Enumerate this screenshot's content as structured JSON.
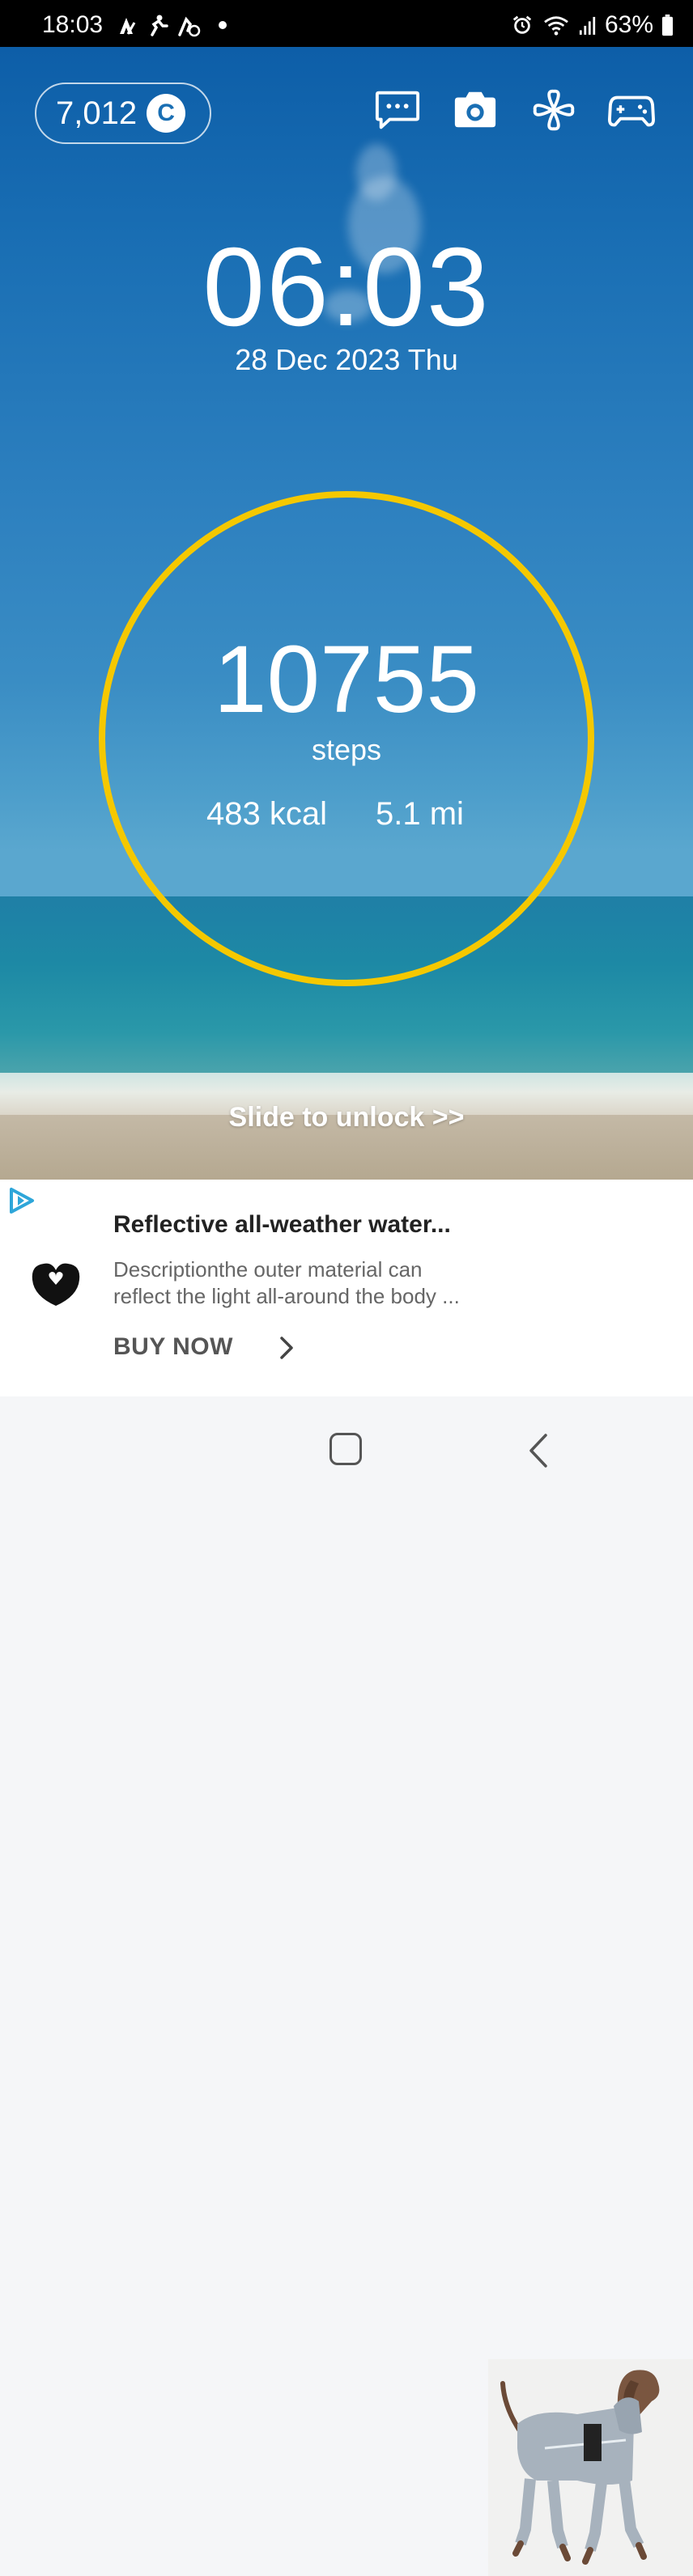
{
  "status_bar": {
    "time": "18:03",
    "battery": "63%",
    "icons": [
      "strava-icon",
      "runner-icon",
      "run-clock-icon",
      "notification-dot",
      "alarm-icon",
      "wifi-icon",
      "signal-icon",
      "battery-icon"
    ]
  },
  "coins": {
    "value": "7,012",
    "symbol": "C"
  },
  "top_actions": [
    "chat-icon",
    "camera-icon",
    "clover-icon",
    "gamepad-icon"
  ],
  "clock": {
    "time": "06:03",
    "date": "28 Dec 2023 Thu"
  },
  "steps": {
    "value": "10755",
    "label": "steps",
    "kcal": "483 kcal",
    "distance": "5.1 mi",
    "ring_color": "#f5c800"
  },
  "unlock": {
    "label": "Slide to unlock >>"
  },
  "ad": {
    "title": "Reflective all-weather water...",
    "description": "Descriptionthe outer material can reflect the light all-around the body ...",
    "cta": "BUY NOW"
  },
  "nav": {
    "home": "home-button",
    "back": "back-button"
  }
}
